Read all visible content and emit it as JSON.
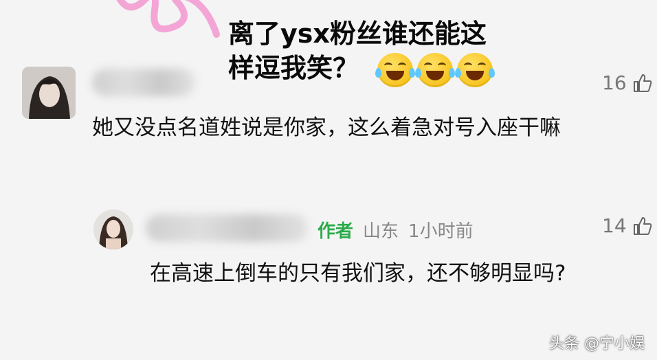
{
  "overlay": {
    "line1": "离了ysx粉丝谁还能这",
    "line2": "样逗我笑？",
    "emojis": [
      "joy-emoji",
      "joy-emoji",
      "joy-emoji"
    ]
  },
  "comments": [
    {
      "avatar": "user-avatar",
      "likes": "16",
      "text": "她又没点名道姓说是你家，这么着急对号入座干嘛"
    },
    {
      "avatar": "author-avatar",
      "author_tag": "作者",
      "location": "山东",
      "time": "1小时前",
      "likes": "14",
      "text": "在高速上倒车的只有我们家，还不够明显吗?"
    }
  ],
  "watermark": "头条 @宁小娱",
  "colors": {
    "accent_green": "#2bab4a",
    "pink_doodle": "#f3a6d6"
  }
}
